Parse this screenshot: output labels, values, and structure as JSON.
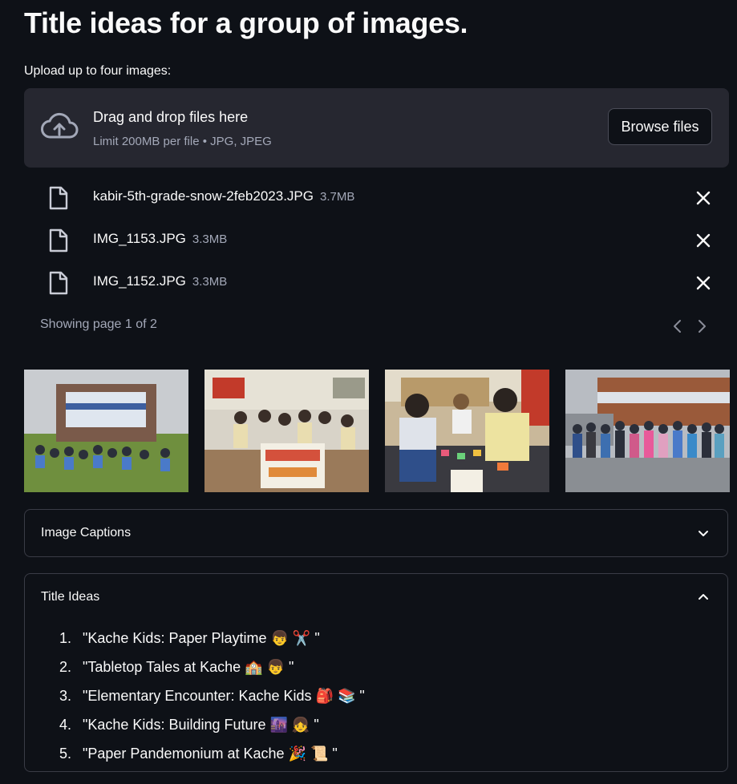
{
  "page": {
    "title": "Title ideas for a group of images.",
    "upload_label": "Upload up to four images:"
  },
  "uploader": {
    "drop_text": "Drag and drop files here",
    "limit_text": "Limit 200MB per file • JPG, JPEG",
    "browse_label": "Browse files",
    "icon": "cloud-upload-icon"
  },
  "files": [
    {
      "name": "kabir-5th-grade-snow-2feb2023.JPG",
      "size": "3.7MB"
    },
    {
      "name": "IMG_1153.JPG",
      "size": "3.3MB"
    },
    {
      "name": "IMG_1152.JPG",
      "size": "3.3MB"
    }
  ],
  "pagination": {
    "text": "Showing page 1 of 2"
  },
  "thumbnails": [
    {
      "description": "kaechele-elementary-sign-group-photo"
    },
    {
      "description": "classroom-origami-sign"
    },
    {
      "description": "students-folding-origami"
    },
    {
      "description": "students-outdoor-group-photo"
    }
  ],
  "captions_expander": {
    "label": "Image Captions",
    "state": "collapsed"
  },
  "ideas_expander": {
    "label": "Title Ideas",
    "state": "expanded",
    "items": [
      {
        "num": "1.",
        "text": "\"Kache Kids: Paper Playtime 👦 ✂️ \""
      },
      {
        "num": "2.",
        "text": "\"Tabletop Tales at Kache 🏫 👦 \""
      },
      {
        "num": "3.",
        "text": "\"Elementary Encounter: Kache Kids 🎒 📚 \""
      },
      {
        "num": "4.",
        "text": "\"Kache Kids: Building Future 🌆 👧 \""
      },
      {
        "num": "5.",
        "text": "\"Paper Pandemonium at Kache 🎉 📜 \""
      }
    ]
  },
  "colors": {
    "background": "#0e1117",
    "surface": "#262730",
    "text": "#fafafa",
    "muted": "#a3a8b8",
    "border": "#3a3c46"
  }
}
